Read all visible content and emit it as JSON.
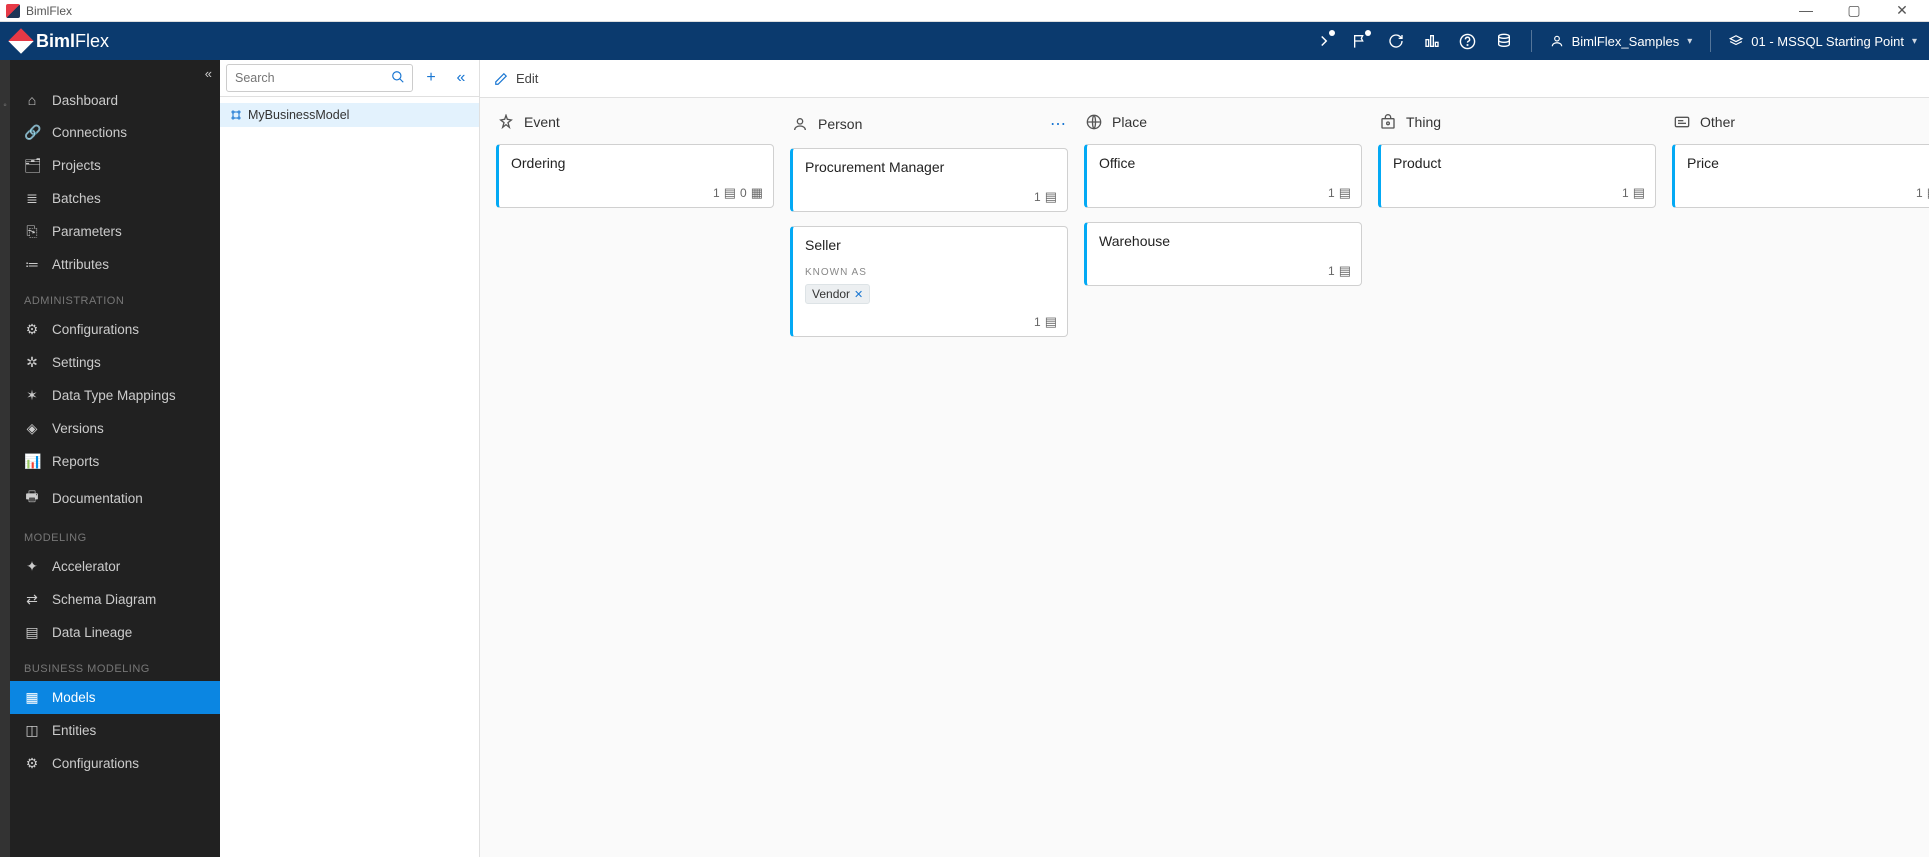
{
  "window": {
    "title": "BimlFlex"
  },
  "brand": {
    "name": "BimlFlex"
  },
  "top": {
    "customer": "BimlFlex_Samples",
    "version": "01 - MSSQL Starting Point"
  },
  "sidebar": {
    "main": [
      {
        "label": "Dashboard",
        "icon": "⌂"
      },
      {
        "label": "Connections",
        "icon": "🔗"
      },
      {
        "label": "Projects",
        "icon": "🗂"
      },
      {
        "label": "Batches",
        "icon": "≣"
      },
      {
        "label": "Parameters",
        "icon": "⎘"
      },
      {
        "label": "Attributes",
        "icon": "≔"
      }
    ],
    "section_admin": "ADMINISTRATION",
    "admin": [
      {
        "label": "Configurations",
        "icon": "⚙"
      },
      {
        "label": "Settings",
        "icon": "✲"
      },
      {
        "label": "Data Type Mappings",
        "icon": "✶"
      },
      {
        "label": "Versions",
        "icon": "◈"
      },
      {
        "label": "Reports",
        "icon": "📊"
      },
      {
        "label": "Documentation",
        "icon": "🖶"
      }
    ],
    "section_modeling": "MODELING",
    "modeling": [
      {
        "label": "Accelerator",
        "icon": "✦"
      },
      {
        "label": "Schema Diagram",
        "icon": "⇄"
      },
      {
        "label": "Data Lineage",
        "icon": "▤"
      }
    ],
    "section_business": "BUSINESS MODELING",
    "business": [
      {
        "label": "Models",
        "icon": "▦",
        "active": true
      },
      {
        "label": "Entities",
        "icon": "◫"
      },
      {
        "label": "Configurations",
        "icon": "⚙"
      }
    ]
  },
  "tree": {
    "search_placeholder": "Search",
    "item": "MyBusinessModel"
  },
  "toolbar": {
    "edit": "Edit"
  },
  "columns": [
    {
      "name": "Event",
      "icon": "✧",
      "cards": [
        {
          "title": "Ordering",
          "badges": [
            {
              "n": "1",
              "i": "▤"
            },
            {
              "n": "0",
              "i": "▦"
            }
          ]
        }
      ]
    },
    {
      "name": "Person",
      "icon": "◉",
      "show_more": true,
      "cards": [
        {
          "title": "Procurement Manager",
          "badges": [
            {
              "n": "1",
              "i": "▤"
            }
          ]
        },
        {
          "title": "Seller",
          "known_as": "KNOWN AS",
          "synonyms": [
            "Vendor"
          ],
          "badges": [
            {
              "n": "1",
              "i": "▤"
            }
          ]
        }
      ]
    },
    {
      "name": "Place",
      "icon": "⛨",
      "cards": [
        {
          "title": "Office",
          "badges": [
            {
              "n": "1",
              "i": "▤"
            }
          ]
        },
        {
          "title": "Warehouse",
          "badges": [
            {
              "n": "1",
              "i": "▤"
            }
          ]
        }
      ]
    },
    {
      "name": "Thing",
      "icon": "▣",
      "cards": [
        {
          "title": "Product",
          "badges": [
            {
              "n": "1",
              "i": "▤"
            }
          ]
        }
      ]
    },
    {
      "name": "Other",
      "icon": "☰",
      "cards": [
        {
          "title": "Price",
          "badges": [
            {
              "n": "1",
              "i": "▤"
            }
          ]
        }
      ]
    }
  ]
}
